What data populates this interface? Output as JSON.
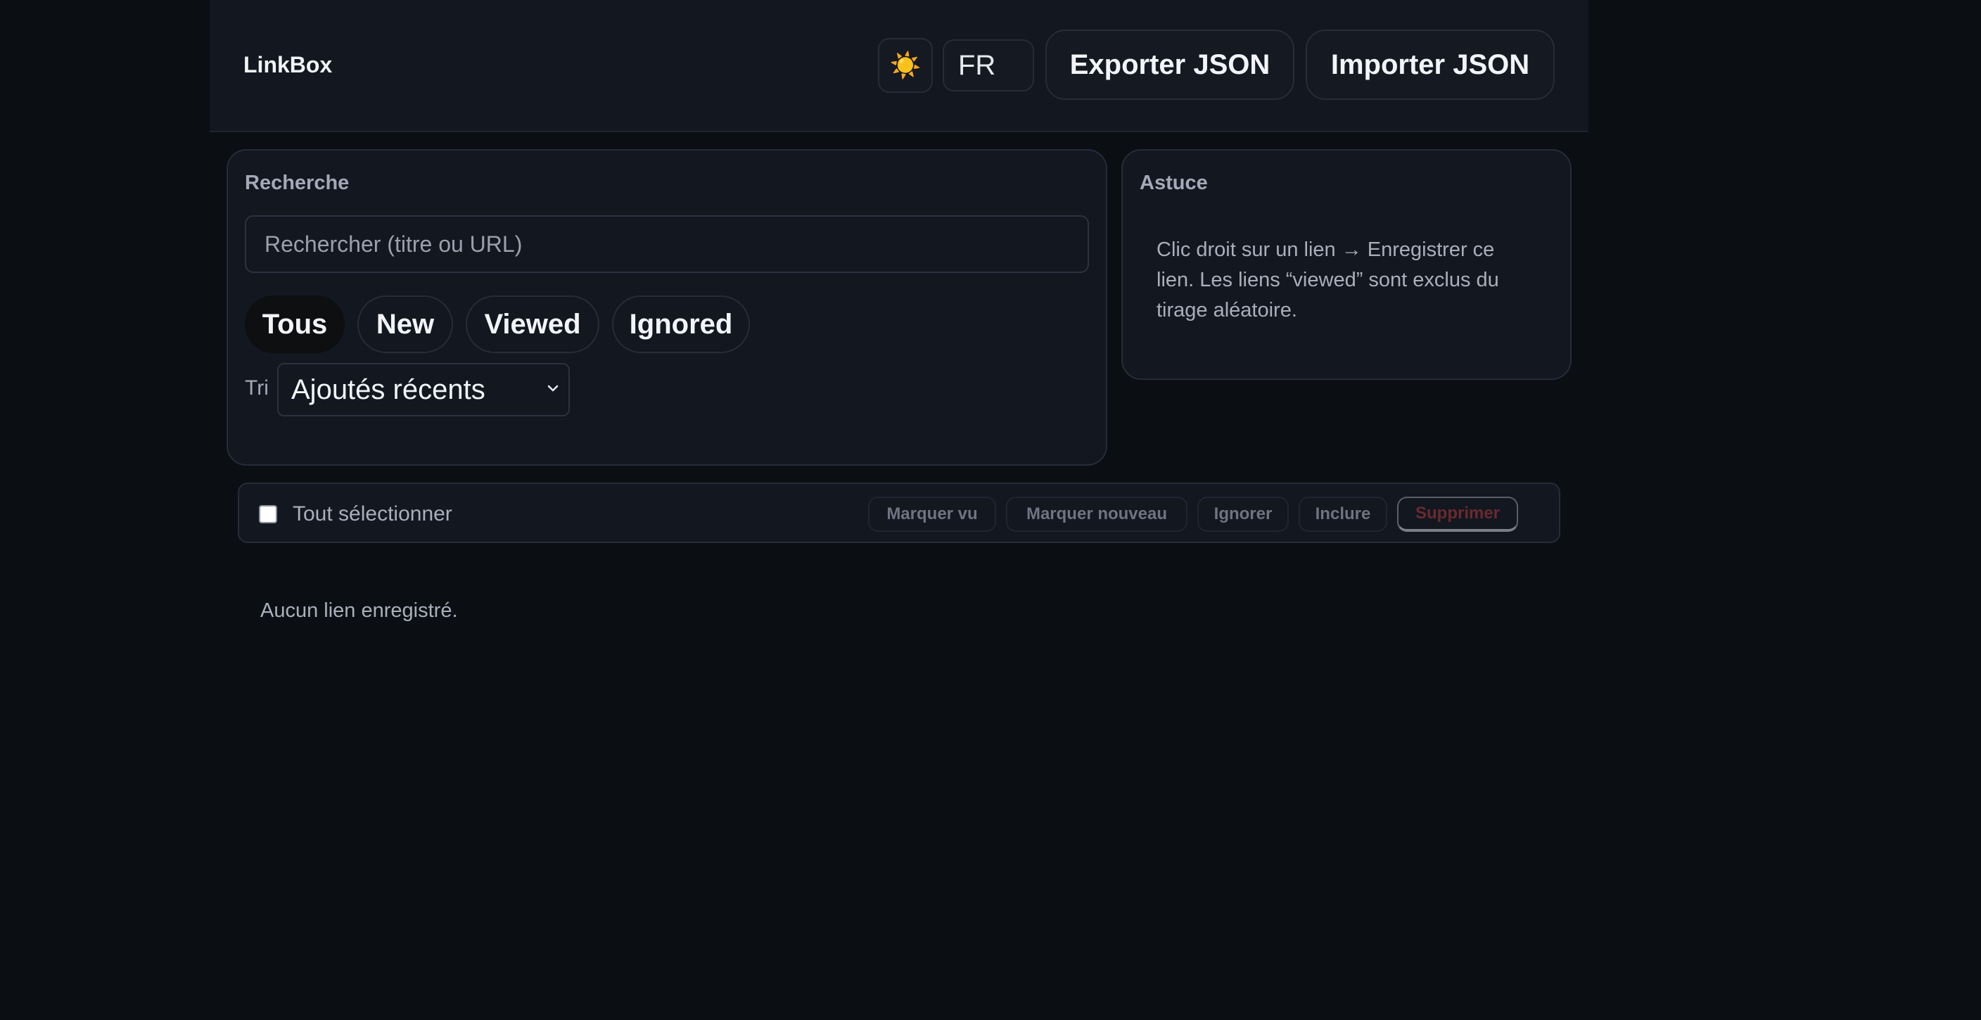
{
  "header": {
    "brand": "LinkBox",
    "theme_icon": "☀️",
    "lang": "FR",
    "export_label": "Exporter JSON",
    "import_label": "Importer JSON"
  },
  "search": {
    "title": "Recherche",
    "placeholder": "Rechercher (titre ou URL)",
    "value": "",
    "filters": [
      {
        "label": "Tous",
        "active": true
      },
      {
        "label": "New",
        "active": false
      },
      {
        "label": "Viewed",
        "active": false
      },
      {
        "label": "Ignored",
        "active": false
      }
    ],
    "sort_label": "Tri",
    "sort_value": "Ajoutés récents"
  },
  "tip": {
    "title": "Astuce",
    "text": "Clic droit sur un lien → Enregistrer ce lien. Les liens “viewed” sont exclus du tirage aléatoire."
  },
  "bulk": {
    "select_all_label": "Tout sélectionner",
    "select_all_checked": false,
    "actions": {
      "mark_seen": "Marquer vu",
      "mark_new": "Marquer nouveau",
      "ignore": "Ignorer",
      "include": "Inclure",
      "delete": "Supprimer"
    }
  },
  "list": {
    "empty_message": "Aucun lien enregistré."
  }
}
